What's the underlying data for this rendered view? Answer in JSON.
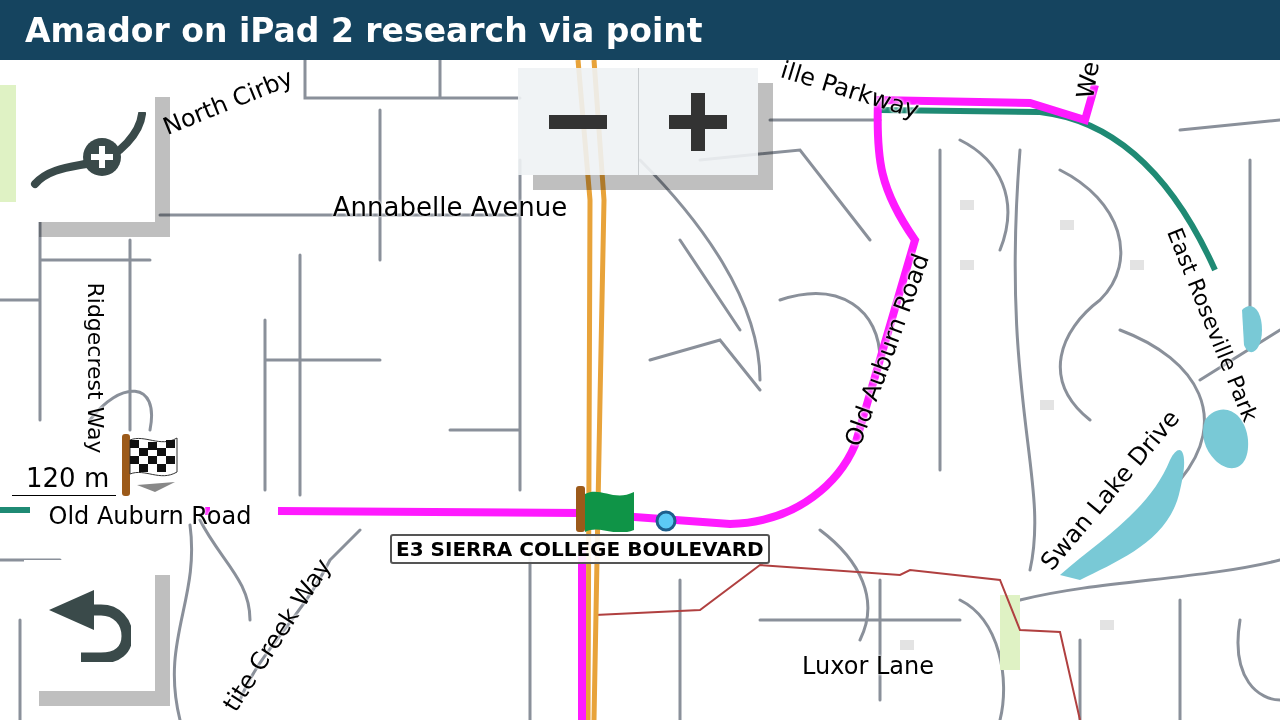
{
  "title_bar": {
    "title": "Amador on iPad 2 research via point"
  },
  "map": {
    "labels": [
      {
        "text": "North Cirby"
      },
      {
        "text": "ille Parkway"
      },
      {
        "text": "We"
      },
      {
        "text": "Annabelle Avenue"
      },
      {
        "text": "Ridgecrest Way"
      },
      {
        "text": "Old Auburn Road"
      },
      {
        "text": "Old Auburn Road"
      },
      {
        "text": "East Roseville Park"
      },
      {
        "text": "Swan Lake Drive"
      },
      {
        "text": "tite Creek Way"
      },
      {
        "text": "Luxor Lane"
      }
    ],
    "current_road": "E3 SIERRA COLLEGE BOULEVARD",
    "scale": "120 m"
  }
}
